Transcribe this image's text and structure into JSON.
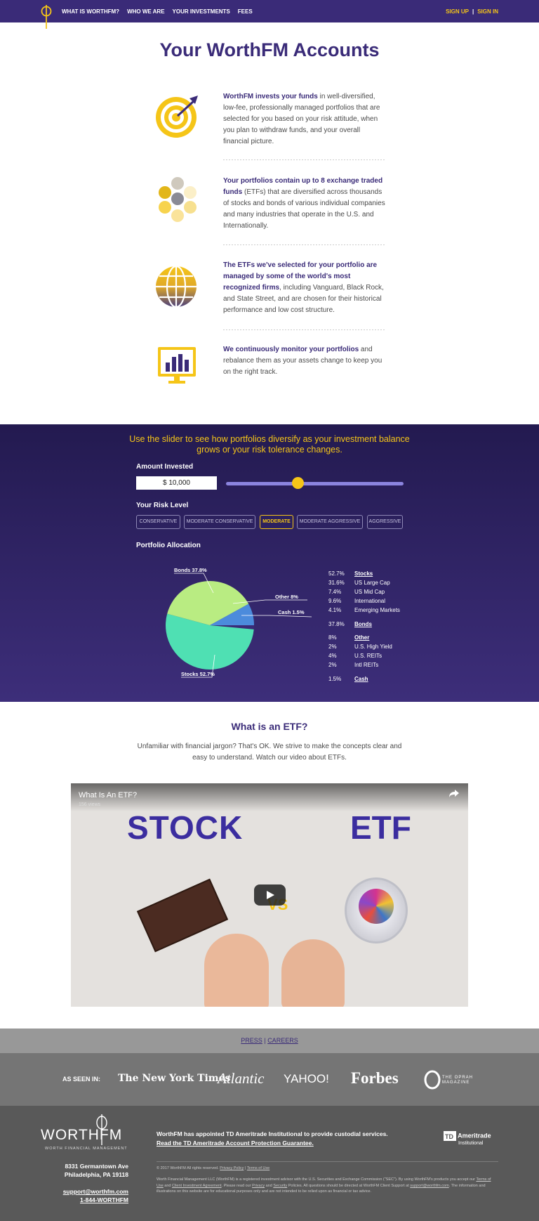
{
  "nav": {
    "links": [
      "WHAT IS WORTHFM?",
      "WHO WE ARE",
      "YOUR INVESTMENTS",
      "FEES"
    ],
    "sign_up": "SIGN UP",
    "sep": "|",
    "sign_in": "SIGN IN"
  },
  "page_title": "Your WorthFM Accounts",
  "features": [
    {
      "bold": "WorthFM invests your funds",
      "text": " in well-diversified, low-fee, professionally managed portfolios that are selected for you based on your risk attitude, when you plan to withdraw funds, and your overall financial picture.",
      "icon": "target-icon"
    },
    {
      "bold": "Your portfolios contain up to 8 exchange traded funds",
      "text": " (ETFs) that are diversified across thousands of stocks and bonds of various individual companies and many industries that operate in the U.S. and Internationally.",
      "icon": "dots-icon"
    },
    {
      "bold": "The ETFs we've selected for your portfolio are managed by some of the world's most recognized firms",
      "text": ", including Vanguard, Black Rock, and State Street, and are chosen for their historical performance and low cost structure.",
      "icon": "globe-icon"
    },
    {
      "bold": "We continuously monitor your portfolios",
      "text": " and rebalance them as your assets change to keep you on the right track.",
      "icon": "monitor-chart-icon"
    }
  ],
  "slider": {
    "heading": "Use the slider to see how portfolios diversify as your investment balance grows or your risk tolerance changes.",
    "amount_label": "Amount Invested",
    "amount_value": "$ 10,000",
    "slider_level": 0.4,
    "risk_label": "Your Risk Level",
    "risk_levels": [
      "CONSERVATIVE",
      "MODERATE CONSERVATIVE",
      "MODERATE",
      "MODERATE AGGRESSIVE",
      "AGGRESSIVE"
    ],
    "risk_selected": "MODERATE",
    "allocation_label": "Portfolio Allocation",
    "pie_labels": {
      "bonds": "Bonds 37.8%",
      "other": "Other 8%",
      "cash": "Cash 1.5%",
      "stocks": "Stocks 52.7%"
    },
    "legend": [
      {
        "value": "52.7%",
        "name": "Stocks",
        "header": true
      },
      {
        "value": "31.6%",
        "name": "US Large Cap"
      },
      {
        "value": "7.4%",
        "name": "US Mid Cap"
      },
      {
        "value": "9.6%",
        "name": "International"
      },
      {
        "value": "4.1%",
        "name": "Emerging Markets"
      },
      {
        "value": "37.8%",
        "name": "Bonds",
        "header": true
      },
      {
        "value": "8%",
        "name": "Other",
        "header": true
      },
      {
        "value": "2%",
        "name": "U.S. High Yield"
      },
      {
        "value": "4%",
        "name": "U.S. REITs"
      },
      {
        "value": "2%",
        "name": "Intl REITs"
      },
      {
        "value": "1.5%",
        "name": "Cash",
        "header": true
      }
    ],
    "colors": {
      "stocks": "#4fe0b3",
      "bonds": "#b9ec82",
      "other": "#4c8bdc",
      "cash": "#3a2b78"
    }
  },
  "chart_data": {
    "type": "pie",
    "categories": [
      "Stocks",
      "Bonds",
      "Other",
      "Cash"
    ],
    "values": [
      52.7,
      37.8,
      8,
      1.5
    ]
  },
  "etf": {
    "title": "What is an ETF?",
    "text": "Unfamiliar with financial jargon? That's OK. We strive to make the concepts clear and easy to understand. Watch our video about ETFs.",
    "video_title": "What Is An ETF?",
    "video_views": "156 views",
    "video_word_left": "STOCK",
    "video_word_right": "ETF",
    "video_vs": "VS"
  },
  "press": {
    "press": "PRESS",
    "sep": "|",
    "careers": "CAREERS"
  },
  "seen": {
    "label": "AS SEEN IN:",
    "logos": [
      "The New York Times",
      "Atlantic",
      "YAHOO!",
      "Forbes",
      "THE OPRAH MAGAZINE"
    ]
  },
  "footer": {
    "brand": "WORTHFM",
    "brand_sub": "WORTH FINANCIAL MANAGEMENT",
    "address1": "8331 Germantown Ave",
    "address2": "Philadelphia, PA 19118",
    "email": "support@worthfm.com",
    "phone": "1-844-WORTHFM",
    "td_text": "WorthFM has appointed TD Ameritrade Institutional to provide custodial services.",
    "td_link": "Read the TD Ameritrade Account Protection Guarantee",
    "td_link_end": ".",
    "copyright": "© 2017 WorthFM All rights reserved.",
    "privacy": "Privacy Policy",
    "copy_sep": "|",
    "terms": "Terms of Use",
    "legal_a": "Worth Financial Management LLC (WorthFM) is a registered investment advisor with the U.S. Securities and Exchange Commission (\"SEC\"). By using WorthFM's products you accept our ",
    "legal_terms": "Terms of Use",
    "legal_b": " and ",
    "legal_cia": "Client Investment Agreement",
    "legal_c": ". Please read our ",
    "legal_privacy": "Privacy",
    "legal_d": " and ",
    "legal_security": "Security",
    "legal_e": " Policies. All questions should be directed at WorthFM Client Support at ",
    "legal_email": "support@worthfm.com",
    "legal_f": ". The information and illustrations on this website are for educational purposes only and are not intended to be relied upon as financial or tax advice.",
    "ameritrade": "Ameritrade",
    "institutional": "Institutional"
  }
}
